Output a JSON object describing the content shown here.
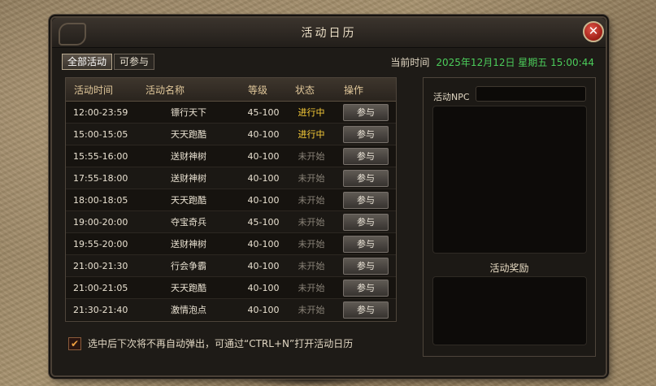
{
  "window": {
    "title": "活动日历",
    "close_symbol": "✕"
  },
  "tabs": [
    {
      "label": "全部活动",
      "active": true
    },
    {
      "label": "可参与",
      "active": false
    }
  ],
  "clock": {
    "label": "当前时间",
    "value": "2025年12月12日 星期五 15:00:44"
  },
  "table": {
    "headers": [
      "活动时间",
      "活动名称",
      "等级",
      "状态",
      "操作"
    ],
    "rows": [
      {
        "time": "12:00-23:59",
        "name": "镖行天下",
        "level": "45-100",
        "status": "进行中",
        "active": true,
        "action": "参与"
      },
      {
        "time": "15:00-15:05",
        "name": "天天跑酷",
        "level": "40-100",
        "status": "进行中",
        "active": true,
        "action": "参与"
      },
      {
        "time": "15:55-16:00",
        "name": "送财神树",
        "level": "40-100",
        "status": "未开始",
        "active": false,
        "action": "参与"
      },
      {
        "time": "17:55-18:00",
        "name": "送财神树",
        "level": "40-100",
        "status": "未开始",
        "active": false,
        "action": "参与"
      },
      {
        "time": "18:00-18:05",
        "name": "天天跑酷",
        "level": "40-100",
        "status": "未开始",
        "active": false,
        "action": "参与"
      },
      {
        "time": "19:00-20:00",
        "name": "夺宝奇兵",
        "level": "45-100",
        "status": "未开始",
        "active": false,
        "action": "参与"
      },
      {
        "time": "19:55-20:00",
        "name": "送财神树",
        "level": "40-100",
        "status": "未开始",
        "active": false,
        "action": "参与"
      },
      {
        "time": "21:00-21:30",
        "name": "行会争霸",
        "level": "40-100",
        "status": "未开始",
        "active": false,
        "action": "参与"
      },
      {
        "time": "21:00-21:05",
        "name": "天天跑酷",
        "level": "40-100",
        "status": "未开始",
        "active": false,
        "action": "参与"
      },
      {
        "time": "21:30-21:40",
        "name": "激情泡点",
        "level": "40-100",
        "status": "未开始",
        "active": false,
        "action": "参与"
      }
    ]
  },
  "side": {
    "npc_label": "活动NPC",
    "npc_value": "",
    "reward_title": "活动奖励"
  },
  "footer": {
    "checked": true,
    "check_symbol": "✔",
    "text": "选中后下次将不再自动弹出，可通过“CTRL+N”打开活动日历"
  },
  "colors": {
    "status_active": "#ffd23a",
    "status_inactive": "#8a8378",
    "clock": "#4ccd5b"
  }
}
